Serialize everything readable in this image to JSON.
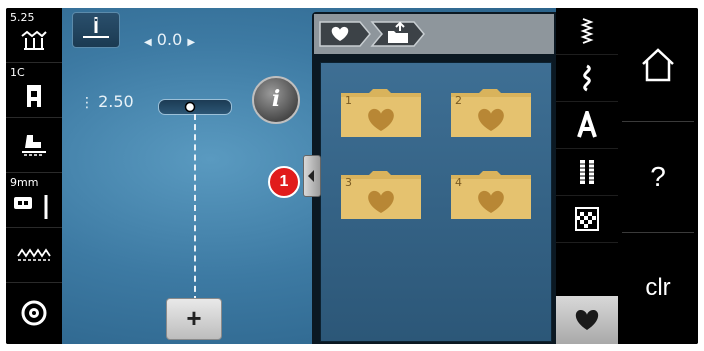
{
  "left_panel": {
    "stitch_width_top": "5.25",
    "presser_foot": "1C",
    "needle_size": "9mm"
  },
  "main": {
    "width_value": "0.0",
    "length_value": "2.50",
    "info_label": "i",
    "add_label": "+"
  },
  "folders": [
    {
      "number": "1"
    },
    {
      "number": "2"
    },
    {
      "number": "3"
    },
    {
      "number": "4"
    }
  ],
  "callout": "1",
  "right_panel": {
    "help_label": "?",
    "clear_label": "clr"
  },
  "colors": {
    "badge": "#e11c1c",
    "folder": "#e5c26f",
    "heart": "#b88735"
  }
}
